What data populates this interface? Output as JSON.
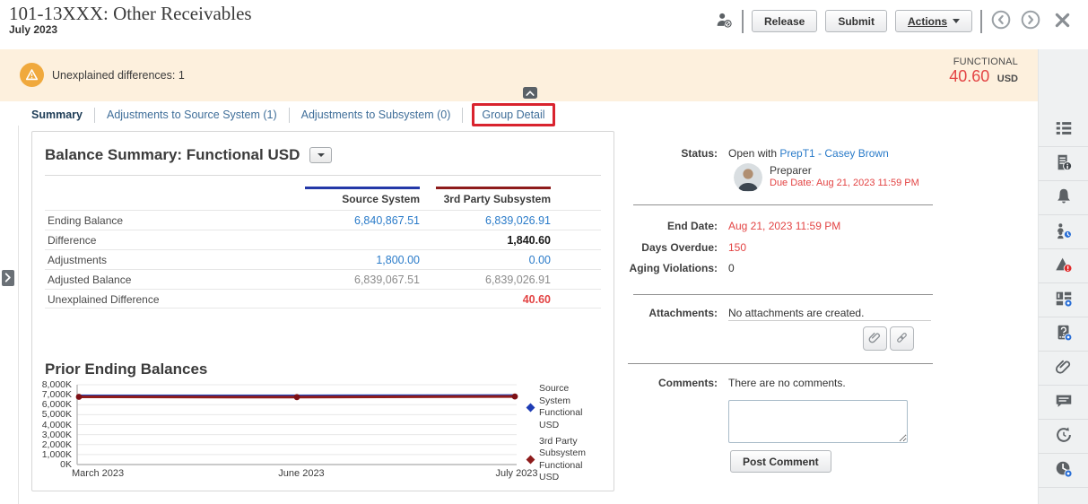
{
  "header": {
    "title": "101-13XXX: Other Receivables",
    "period": "July 2023",
    "buttons": {
      "release": "Release",
      "submit": "Submit",
      "actions": "Actions"
    }
  },
  "banner": {
    "warning": "Unexplained differences: 1",
    "balance_type": "FUNCTIONAL",
    "amount": "40.60",
    "currency": "USD",
    "background": "#fdf0dd",
    "amount_color": "#e34444"
  },
  "tabs": {
    "summary": "Summary",
    "adj_source": "Adjustments to Source System (1)",
    "adj_subsystem": "Adjustments to Subsystem (0)",
    "group_detail": "Group Detail",
    "highlight_color": "#d9232e"
  },
  "balance_summary": {
    "title": "Balance Summary: Functional USD",
    "columns": {
      "source": "Source System",
      "subsystem": "3rd Party Subsystem"
    },
    "column_colors": {
      "source": "#2438a8",
      "subsystem": "#8e1c1c"
    },
    "rows": [
      {
        "label": "Ending Balance",
        "source": "6,840,867.51",
        "subsystem": "6,839,026.91"
      },
      {
        "label": "Difference",
        "source": "",
        "subsystem": "1,840.60"
      },
      {
        "label": "Adjustments",
        "source": "1,800.00",
        "subsystem": "0.00"
      },
      {
        "label": "Adjusted Balance",
        "source": "6,839,067.51",
        "subsystem": "6,839,026.91"
      },
      {
        "label": "Unexplained Difference",
        "source": "",
        "subsystem": "40.60"
      }
    ]
  },
  "chart_data": {
    "type": "line",
    "title": "Prior Ending Balances",
    "x": [
      "March 2023",
      "June 2023",
      "July 2023"
    ],
    "series": [
      {
        "name": "Source System Functional USD",
        "color": "#1f3db5",
        "values_k": [
          6800,
          6800,
          6841
        ]
      },
      {
        "name": "3rd Party Subsystem Functional USD",
        "color": "#8e1c1c",
        "values_k": [
          6800,
          6800,
          6839
        ]
      }
    ],
    "ylim_k": [
      0,
      8000
    ],
    "ytick_step_k": 1000,
    "yticks": [
      "8,000K",
      "7,000K",
      "6,000K",
      "5,000K",
      "4,000K",
      "3,000K",
      "2,000K",
      "1,000K",
      "0K"
    ],
    "grid": true,
    "legend_position": "right"
  },
  "workflow": {
    "status_label": "Status:",
    "status_prefix": "Open with ",
    "assignee": "PrepT1 - Casey Brown",
    "role": "Preparer",
    "due_label": "Due Date:  ",
    "due_value": "Aug 21, 2023 11:59 PM",
    "end_date_label": "End Date:",
    "end_date": "Aug 21, 2023 11:59 PM",
    "days_overdue_label": "Days Overdue:",
    "days_overdue": "150",
    "aging_label": "Aging Violations:",
    "aging": "0"
  },
  "attachments": {
    "label": "Attachments:",
    "empty_text": "No attachments are created."
  },
  "comments": {
    "label": "Comments:",
    "empty_text": "There are no comments.",
    "post_button": "Post Comment"
  },
  "sidebar_icons": [
    "list-icon",
    "instructions-icon",
    "alerts-icon",
    "workflow-users-icon",
    "warnings-icon",
    "attributes-icon",
    "questions-icon",
    "attachments-icon",
    "comments-icon",
    "prior-reconciliations-icon",
    "history-icon"
  ]
}
